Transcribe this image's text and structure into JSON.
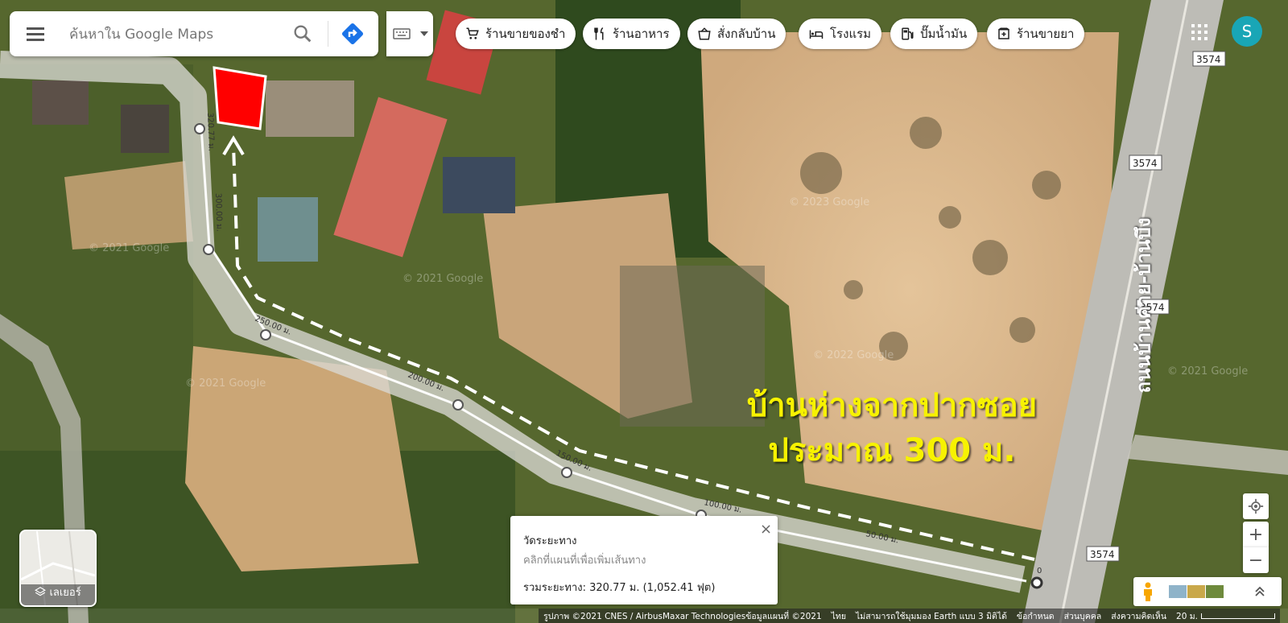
{
  "search": {
    "placeholder": "ค้นหาใน Google Maps"
  },
  "chips": [
    {
      "label": "ร้านขายของชำ",
      "icon": "cart-icon"
    },
    {
      "label": "ร้านอาหาร",
      "icon": "utensils-icon"
    },
    {
      "label": "สั่งกลับบ้าน",
      "icon": "takeout-icon"
    },
    {
      "label": "โรงแรม",
      "icon": "bed-icon"
    },
    {
      "label": "ปั๊มน้ำมัน",
      "icon": "gas-icon"
    },
    {
      "label": "ร้านขายยา",
      "icon": "pharmacy-icon"
    }
  ],
  "account": {
    "initial": "S",
    "color": "#19a6b6"
  },
  "layers": {
    "label": "เลเยอร์"
  },
  "measure": {
    "title": "วัดระยะทาง",
    "hint": "คลิกที่แผนที่เพื่อเพิ่มเส้นทาง",
    "total": "รวมระยะทาง: 320.77 ม. (1,052.41 ฟุต)",
    "close": "×"
  },
  "annotation": {
    "line1": "บ้านห่างจากปากซอย",
    "line2": "ประมาณ 300 ม.",
    "color": "#f7f200"
  },
  "road": {
    "name": "ถนนบ้านค่าย-บ้านบึง",
    "route_number": "3574"
  },
  "distance_labels": [
    "0",
    "50.00 ม.",
    "100.00 ม.",
    "150.00 ม.",
    "200.00 ม.",
    "250.00 ม.",
    "300.00 ม.",
    "320.77 ม."
  ],
  "watermarks": [
    "© 2021 Google",
    "© 2023 Google",
    "© 2022 Google"
  ],
  "footer": {
    "imagery": "รูปภาพ ©2021 CNES / AirbusMaxar Technologiesข้อมูลแผนที่ ©2021",
    "language": "ไทย",
    "earth": "ไม่สามารถใช้มุมมอง Earth แบบ 3 มิติได้",
    "terms": "ข้อกำหนด",
    "privacy": "ส่วนบุคคล",
    "feedback": "ส่งความคิดเห็น",
    "scale": "20 ม."
  },
  "colors": {
    "marker": "#ff0000",
    "measure_line": "#ffffff",
    "accent": "#1a73e8"
  }
}
